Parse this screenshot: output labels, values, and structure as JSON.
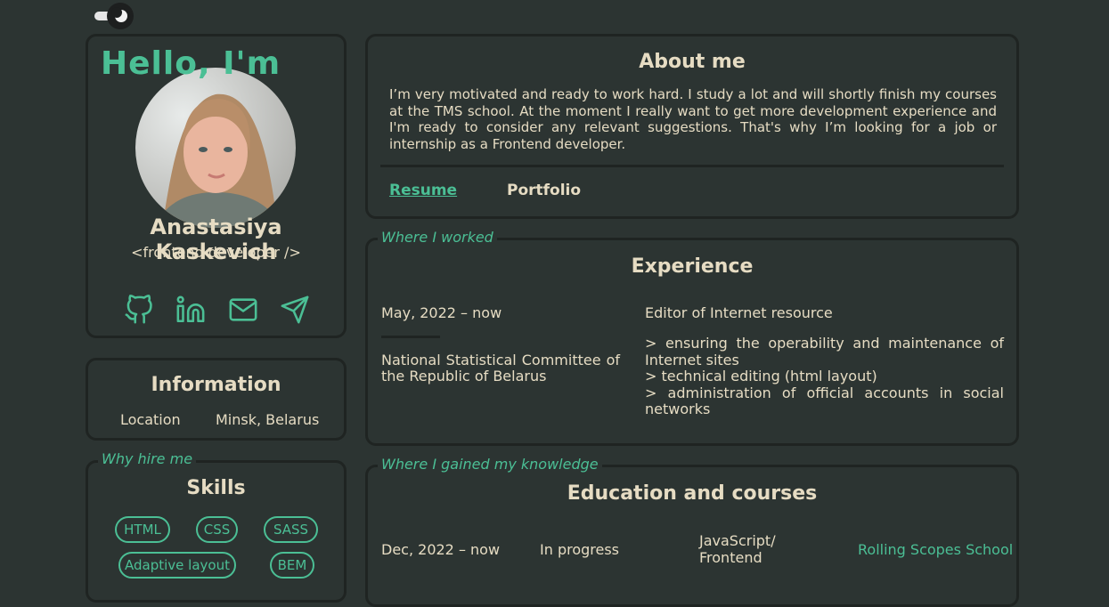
{
  "theme_toggle": {
    "icon": "moon-icon"
  },
  "profile": {
    "greeting": "Hello, I'm",
    "name": "Anastasiya Kaskevich",
    "role": "<frontend developer />",
    "socials": [
      "github-icon",
      "linkedin-icon",
      "mail-icon",
      "telegram-icon"
    ]
  },
  "info": {
    "title": "Information",
    "location_label": "Location",
    "location_value": "Minsk, Belarus"
  },
  "skills": {
    "legend": "Why hire me",
    "title": "Skills",
    "items": [
      "HTML",
      "CSS",
      "SASS",
      "Adaptive layout",
      "BEM"
    ]
  },
  "about": {
    "title": "About me",
    "text": "I’m very motivated and ready to work hard. I study a lot and will shortly finish my courses at the TMS school. At the moment I really want to get more development experience and I'm ready to consider any relevant suggestions. That's why I’m looking for a job or internship as a Frontend developer.",
    "resume_label": "Resume",
    "portfolio_label": "Portfolio"
  },
  "experience": {
    "legend": "Where I worked",
    "title": "Experience",
    "date": "May, 2022 – now",
    "organization": "National Statistical Committee of the Republic of Belarus",
    "position": "Editor of Internet resource",
    "duties": [
      "> ensuring the operability and maintenance of Internet sites",
      "> technical editing (html layout)",
      "> administration of official accounts in social networks"
    ]
  },
  "education": {
    "legend": "Where I gained my knowledge",
    "title": "Education and courses",
    "date": "Dec, 2022 – now",
    "status": "In progress",
    "course": "JavaScript/ Frontend",
    "school": "Rolling Scopes School"
  },
  "colors": {
    "background": "#2c3432",
    "accent": "#4bbf95",
    "text": "#e6dcc3",
    "border": "#1f2422"
  }
}
